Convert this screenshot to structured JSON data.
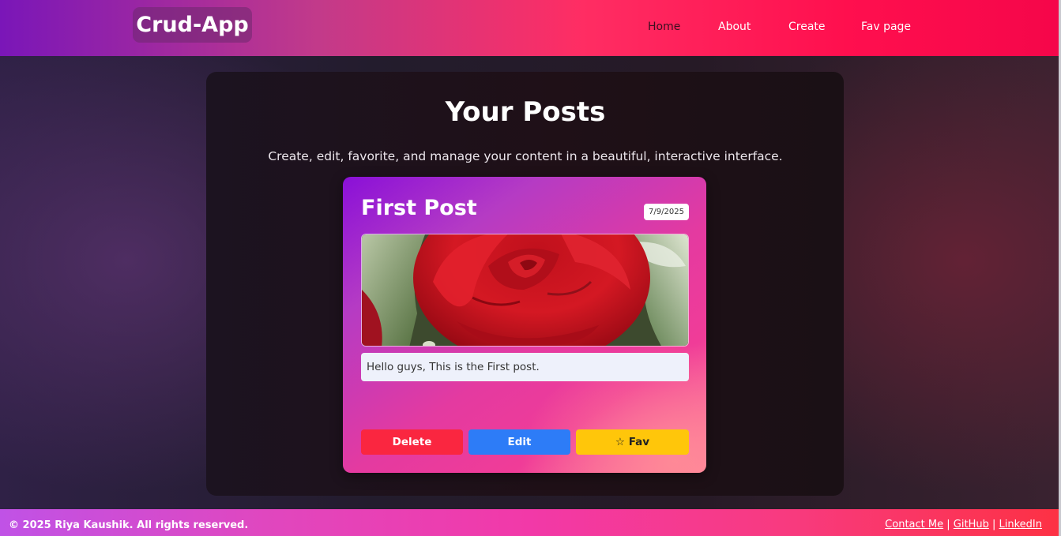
{
  "brand": {
    "label": "Crud-App"
  },
  "nav": {
    "links": [
      {
        "label": "Home",
        "active": true
      },
      {
        "label": "About",
        "active": false
      },
      {
        "label": "Create",
        "active": false
      },
      {
        "label": "Fav page",
        "active": false
      }
    ]
  },
  "main": {
    "title": "Your Posts",
    "subtitle": "Create, edit, favorite, and manage your content in a beautiful, interactive interface."
  },
  "posts": [
    {
      "title": "First Post",
      "date": "7/9/2025",
      "image": "rose-image",
      "body": "Hello guys, This is the First post.",
      "actions": {
        "delete_label": "Delete",
        "edit_label": "Edit",
        "fav_label": "☆ Fav"
      }
    }
  ],
  "footer": {
    "copyright": "© 2025 Riya Kaushik. All rights reserved.",
    "links": [
      {
        "label": "Contact Me"
      },
      {
        "label": "GitHub"
      },
      {
        "label": "LinkedIn"
      }
    ],
    "separator": "|"
  },
  "colors": {
    "delete": "#fa2640",
    "edit": "#2d7cf7",
    "fav": "#ffc60a",
    "nav_accent": "#ff2d63"
  }
}
